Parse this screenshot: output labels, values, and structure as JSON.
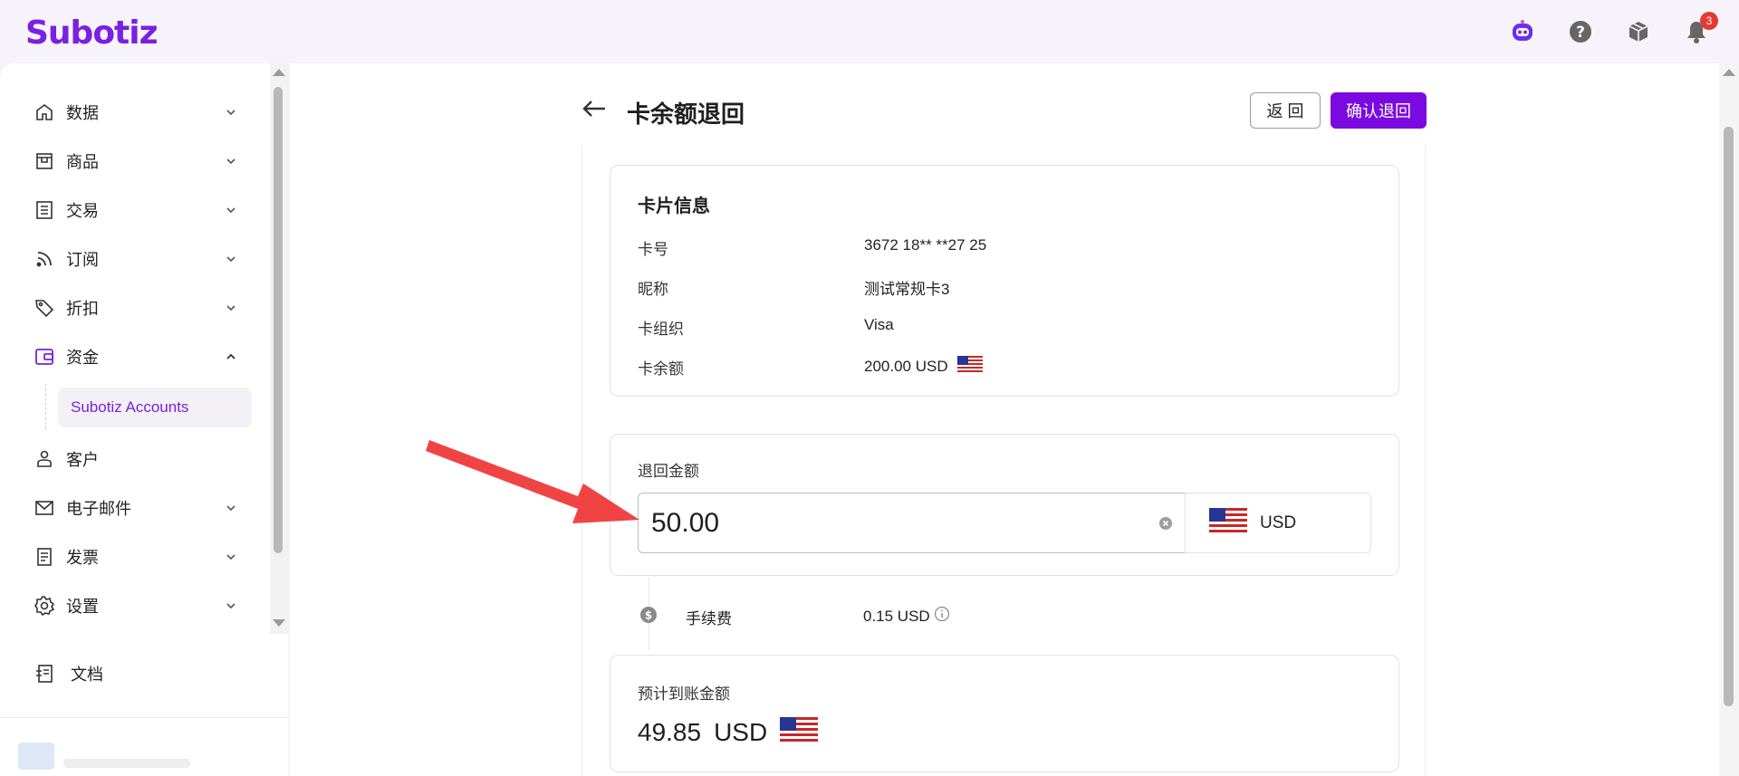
{
  "brand": {
    "name": "Subotiz",
    "color": "#7b1fe0"
  },
  "topbar": {
    "notification_count": "3"
  },
  "sidebar": {
    "items": [
      {
        "label": "数据",
        "icon": "home-icon"
      },
      {
        "label": "商品",
        "icon": "store-icon"
      },
      {
        "label": "交易",
        "icon": "list-icon"
      },
      {
        "label": "订阅",
        "icon": "rss-icon"
      },
      {
        "label": "折扣",
        "icon": "tag-icon"
      },
      {
        "label": "资金",
        "icon": "wallet-icon",
        "expanded": true
      },
      {
        "label": "客户",
        "icon": "user-icon"
      },
      {
        "label": "电子邮件",
        "icon": "mail-icon"
      },
      {
        "label": "发票",
        "icon": "invoice-icon"
      },
      {
        "label": "设置",
        "icon": "gear-icon"
      }
    ],
    "submenu_active": "Subotiz Accounts",
    "docs_label": "文档"
  },
  "page": {
    "title": "卡余额退回",
    "back_button": "返 回",
    "confirm_button": "确认退回"
  },
  "card_info": {
    "title": "卡片信息",
    "rows": [
      {
        "key": "卡号",
        "value": "3672 18** **27 25"
      },
      {
        "key": "昵称",
        "value": "测试常规卡3"
      },
      {
        "key": "卡组织",
        "value": "Visa"
      },
      {
        "key": "卡余额",
        "value": "200.00 USD"
      }
    ]
  },
  "refund": {
    "label": "退回金额",
    "amount": "50.00",
    "currency": "USD"
  },
  "fee": {
    "label": "手续费",
    "value": "0.15 USD"
  },
  "estimate": {
    "label": "预计到账金额",
    "amount": "49.85",
    "currency": "USD"
  },
  "colors": {
    "accent": "#7a0ae0",
    "arrow": "#f04444",
    "badge": "#e53935"
  }
}
